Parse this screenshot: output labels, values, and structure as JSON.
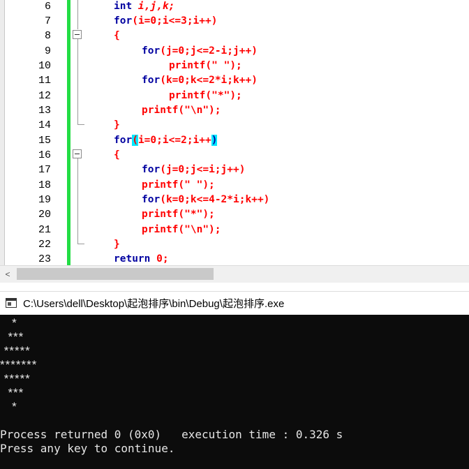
{
  "editor": {
    "line_numbers": [
      "6",
      "7",
      "8",
      "9",
      "10",
      "11",
      "12",
      "13",
      "14",
      "15",
      "16",
      "17",
      "18",
      "19",
      "20",
      "21",
      "22",
      "23"
    ],
    "code": {
      "l6": [
        "int ",
        "i,j,k;"
      ],
      "l7": [
        "for",
        "(",
        "i=",
        "0",
        ";",
        "i<=",
        "3",
        ";",
        "i++)"
      ],
      "l8": [
        "{"
      ],
      "l9": [
        "for",
        "(",
        "j=",
        "0",
        ";",
        "j<=",
        "2",
        "-",
        "i;",
        "j++)"
      ],
      "l10": [
        "printf",
        "(",
        "\" \"",
        ");"
      ],
      "l11": [
        "for",
        "(",
        "k=",
        "0",
        ";",
        "k<=",
        "2",
        "*",
        "i;",
        "k++)"
      ],
      "l12": [
        "printf",
        "(",
        "\"*\"",
        ");"
      ],
      "l13": [
        "printf",
        "(",
        "\"\\n\"",
        ");"
      ],
      "l14": [
        "}"
      ],
      "l15": [
        "for",
        "(",
        "i=",
        "0",
        ";",
        "i<=",
        "2",
        ";",
        "i++",
        ")"
      ],
      "l16": [
        "{"
      ],
      "l17": [
        "for",
        "(",
        "j=",
        "0",
        ";",
        "j<=",
        "i;",
        "j++)"
      ],
      "l18": [
        "printf",
        "(",
        "\" \"",
        ");"
      ],
      "l19": [
        "for",
        "(",
        "k=",
        "0",
        ";",
        "k<=",
        "4",
        "-",
        "2",
        "*",
        "i;",
        "k++)"
      ],
      "l20": [
        "printf",
        "(",
        "\"*\"",
        ");"
      ],
      "l21": [
        "printf",
        "(",
        "\"\\n\"",
        ");"
      ],
      "l22": [
        "}"
      ],
      "l23": [
        "return ",
        "0;"
      ]
    }
  },
  "scrollbar": {
    "left_arrow": "<"
  },
  "console": {
    "title": "C:\\Users\\dell\\Desktop\\起泡排序\\bin\\Debug\\起泡排序.exe",
    "output_lines": [
      "   *",
      "  ***",
      " *****",
      "*******",
      " *****",
      "  ***",
      "   *"
    ],
    "status_line": "Process returned 0 (0x0)   execution time : 0.326 s",
    "prompt_line": "Press any key to continue."
  },
  "colors": {
    "change_bar": "#22dd44",
    "bracket_highlight": "#00e8ff",
    "console_bg": "#0c0c0c"
  }
}
